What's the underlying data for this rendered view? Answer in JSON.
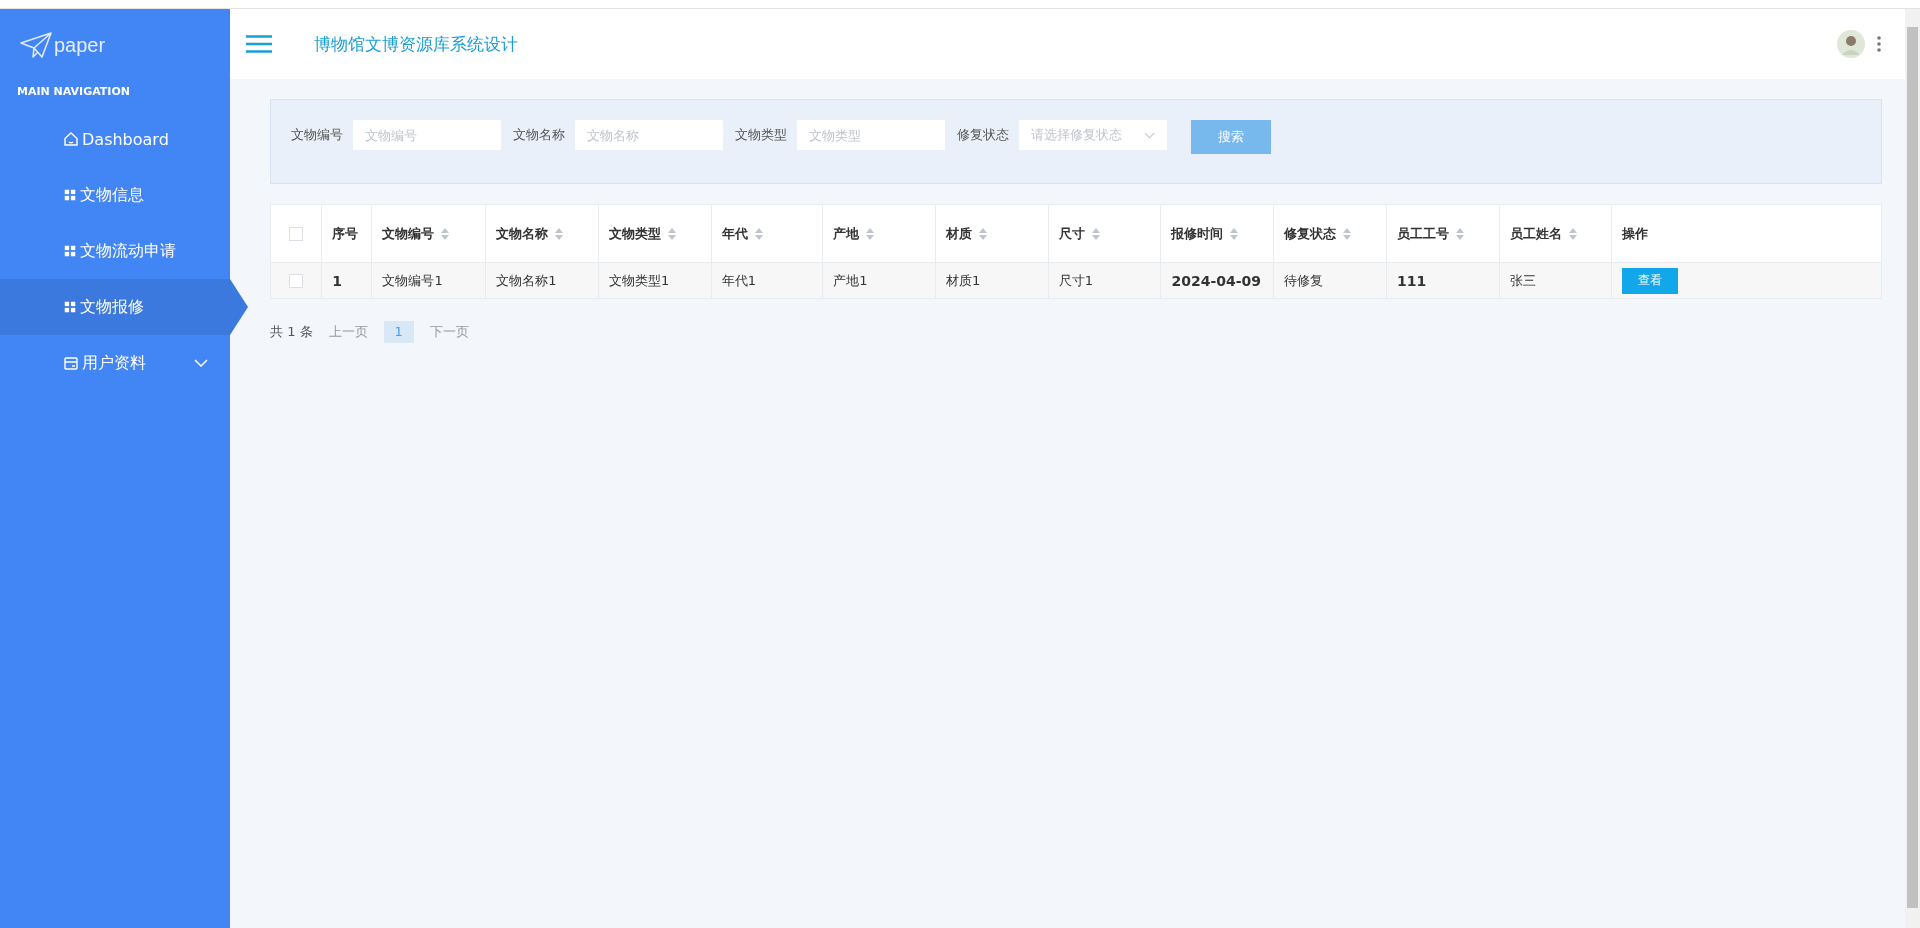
{
  "brand": "paper",
  "sidebar": {
    "heading": "MAIN NAVIGATION",
    "items": [
      {
        "label": "Dashboard",
        "kind": "home",
        "selected": false
      },
      {
        "label": "文物信息",
        "kind": "grid",
        "selected": false
      },
      {
        "label": "文物流动申请",
        "kind": "grid",
        "selected": false
      },
      {
        "label": "文物报修",
        "kind": "grid",
        "selected": true
      },
      {
        "label": "用户资料",
        "kind": "card",
        "selected": false,
        "expanded": false
      }
    ]
  },
  "header": {
    "title": "博物馆文博资源库系统设计"
  },
  "search": {
    "fields": [
      {
        "label": "文物编号",
        "placeholder": "文物编号",
        "kind": "input"
      },
      {
        "label": "文物名称",
        "placeholder": "文物名称",
        "kind": "input"
      },
      {
        "label": "文物类型",
        "placeholder": "文物类型",
        "kind": "input"
      },
      {
        "label": "修复状态",
        "placeholder": "请选择修复状态",
        "kind": "select"
      }
    ],
    "button": "搜索"
  },
  "table": {
    "columns": [
      {
        "label": "序号",
        "sortable": false
      },
      {
        "label": "文物编号",
        "sortable": true
      },
      {
        "label": "文物名称",
        "sortable": true
      },
      {
        "label": "文物类型",
        "sortable": true
      },
      {
        "label": "年代",
        "sortable": true
      },
      {
        "label": "产地",
        "sortable": true
      },
      {
        "label": "材质",
        "sortable": true
      },
      {
        "label": "尺寸",
        "sortable": true
      },
      {
        "label": "报修时间",
        "sortable": true
      },
      {
        "label": "修复状态",
        "sortable": true
      },
      {
        "label": "员工工号",
        "sortable": true
      },
      {
        "label": "员工姓名",
        "sortable": true
      },
      {
        "label": "操作",
        "sortable": false
      }
    ],
    "rows": [
      {
        "checked": false,
        "cells": [
          "1",
          "文物编号1",
          "文物名称1",
          "文物类型1",
          "年代1",
          "产地1",
          "材质1",
          "尺寸1",
          "2024-04-09",
          "待修复",
          "111",
          "张三"
        ],
        "action": "查看"
      }
    ],
    "header_checked": false
  },
  "pagination": {
    "total": "共 1 条",
    "prev": "上一页",
    "pages": [
      {
        "label": "1",
        "selected": true
      }
    ],
    "next": "下一页"
  }
}
